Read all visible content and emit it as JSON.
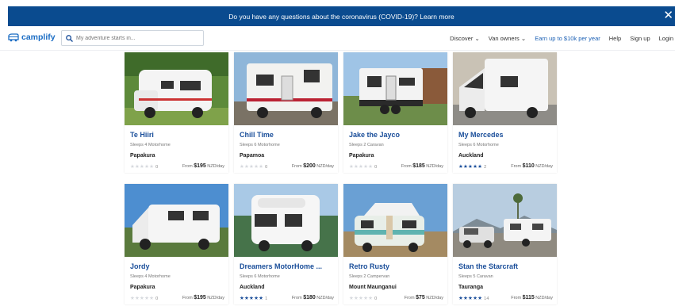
{
  "banner": {
    "text": "Do you have any questions about the coronavirus (COVID-19)? Learn more",
    "close_icon": "close-icon"
  },
  "header": {
    "logo": "camplify",
    "search_placeholder": "My adventure starts in...",
    "nav": {
      "discover": "Discover",
      "van_owners": "Van owners",
      "earn": "Earn up to $10k per year",
      "help": "Help",
      "signup": "Sign up",
      "login": "Login"
    }
  },
  "listings": [
    {
      "title": "Te Hiiri",
      "sleeps": "Sleeps 4",
      "type": "Motorhome",
      "location": "Papakura",
      "rating": 0,
      "reviews": "0",
      "from": "From",
      "price": "$195",
      "unit": "NZD/day"
    },
    {
      "title": "Chill Time",
      "sleeps": "Sleeps 6",
      "type": "Motorhome",
      "location": "Papamoa",
      "rating": 0,
      "reviews": "0",
      "from": "From",
      "price": "$200",
      "unit": "NZD/day"
    },
    {
      "title": "Jake the Jayco",
      "sleeps": "Sleeps 2",
      "type": "Caravan",
      "location": "Papakura",
      "rating": 0,
      "reviews": "0",
      "from": "From",
      "price": "$185",
      "unit": "NZD/day"
    },
    {
      "title": "My Mercedes",
      "sleeps": "Sleeps 6",
      "type": "Motorhome",
      "location": "Auckland",
      "rating": 5,
      "reviews": "2",
      "from": "From",
      "price": "$110",
      "unit": "NZD/day"
    },
    {
      "title": "Jordy",
      "sleeps": "Sleeps 4",
      "type": "Motorhome",
      "location": "Papakura",
      "rating": 0,
      "reviews": "0",
      "from": "From",
      "price": "$195",
      "unit": "NZD/day"
    },
    {
      "title": "Dreamers MotorHome ...",
      "sleeps": "Sleeps 6",
      "type": "Motorhome",
      "location": "Auckland",
      "rating": 5,
      "reviews": "1",
      "from": "From",
      "price": "$180",
      "unit": "NZD/day"
    },
    {
      "title": "Retro Rusty",
      "sleeps": "Sleeps 2",
      "type": "Campervan",
      "location": "Mount Maunganui",
      "rating": 0,
      "reviews": "0",
      "from": "From",
      "price": "$75",
      "unit": "NZD/day"
    },
    {
      "title": "Stan the Starcraft",
      "sleeps": "Sleeps 5",
      "type": "Caravan",
      "location": "Tauranga",
      "rating": 5,
      "reviews": "14",
      "from": "From",
      "price": "$115",
      "unit": "NZD/day"
    }
  ],
  "colors": {
    "banner": "#0a4b8f",
    "brand": "#1a6cc4",
    "title": "#1a4e9a"
  }
}
